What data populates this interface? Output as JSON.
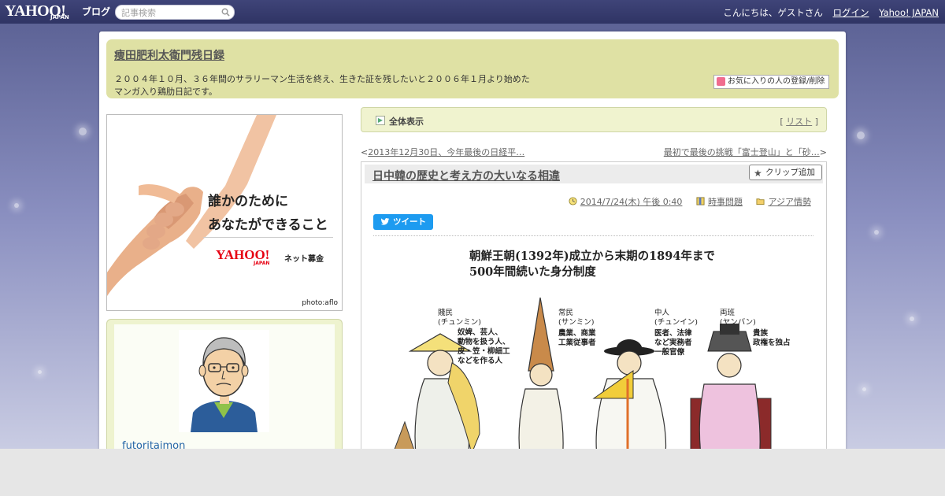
{
  "topbar": {
    "logo": "YAHOO!",
    "logo_sub": "JAPAN",
    "logo_blog": "ブログ",
    "search_placeholder": "記事検索",
    "greeting": "こんにちは、ゲストさん",
    "login": "ログイン",
    "yahoo_japan": "Yahoo! JAPAN"
  },
  "header": {
    "title": "痩田肥利太衛門残日録",
    "description": "２００４年１０月、３６年間のサラリーマン生活を終え、生きた証を残したいと２００６年１月より始めた\nマンガ入り鶏肋日記です。",
    "favorite_button": "お気に入りの人の登録/削除"
  },
  "ad": {
    "line1": "誰かのために",
    "line2": "あなたができること",
    "logo": "YAHOO!",
    "logo_sub": "JAPAN",
    "tagline": "ネット募金",
    "credit": "photo:aflo"
  },
  "profile": {
    "name": "futoritaimon"
  },
  "entry_nav": {
    "label": "全体表示",
    "list_open": "[ ",
    "list_link": "リスト",
    "list_close": " ]"
  },
  "pager": {
    "prev_mark": "<",
    "prev_link": "2013年12月30日、今年最後の日経平…",
    "next_link": "最初で最後の挑戦「富士登山」と「砂…",
    "next_mark": ">"
  },
  "article": {
    "title": "日中韓の歴史と考え方の大いなる相違",
    "clip_button": "クリップ追加",
    "date": "2014/7/24(木) 午後 0:40",
    "category": "時事問題",
    "tag": "アジア情勢",
    "tweet": "ツイート",
    "illustration": {
      "title_line1": "朝鮮王朝(1392年)成立から末期の1894年まで",
      "title_line2": "500年間続いた身分制度",
      "class1_name": "賤民\n(チュンミン)",
      "class1_desc": "奴婢、芸人、\n動物を扱う人、\n皮・笠・柳細工\nなどを作る人",
      "class2_name": "常民\n(サンミン)",
      "class2_desc": "農業、商業\n工業従事者",
      "class3_name": "中人\n(チュンイン)",
      "class3_desc": "医者、法律\nなど実務者\n一般官僚",
      "class4_name": "両班\n(ヤンバン)",
      "class4_desc": "貴族\n政権を独占"
    }
  },
  "colors": {
    "topbar": "#363b6e",
    "header_bg": "#dfe1a4",
    "nav_bg": "#f0f3cf",
    "link": "#666666",
    "tweet": "#1d9bf0",
    "profile_name": "#2565a7"
  }
}
